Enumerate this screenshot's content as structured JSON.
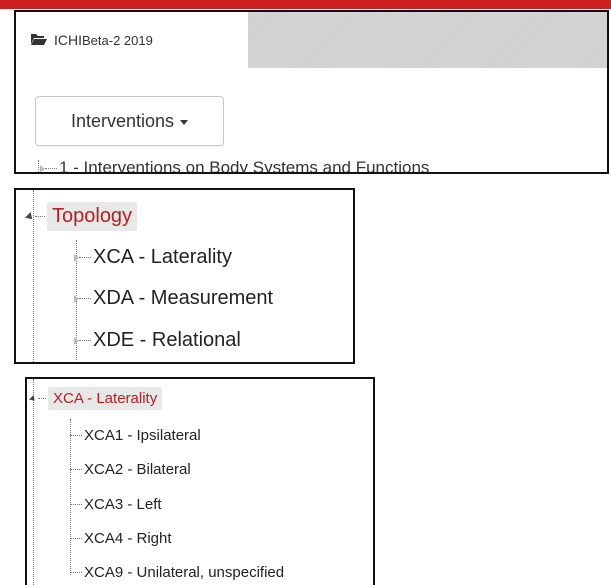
{
  "tab": {
    "icon": "folder-open-icon",
    "label_main": "ICHI ",
    "label_small": "Beta-2 2019"
  },
  "dropdown": {
    "label": "Interventions"
  },
  "tree_top": {
    "item_label": "1 - Interventions on Body Systems and Functions"
  },
  "topology": {
    "label": "Topology",
    "children": [
      {
        "label": "XCA - Laterality"
      },
      {
        "label": "XDA - Measurement"
      },
      {
        "label": "XDE - Relational"
      }
    ]
  },
  "laterality": {
    "label": "XCA - Laterality",
    "children": [
      {
        "label": "XCA1 - Ipsilateral"
      },
      {
        "label": "XCA2 - Bilateral"
      },
      {
        "label": "XCA3 - Left"
      },
      {
        "label": "XCA4 - Right"
      },
      {
        "label": "XCA9 - Unilateral, unspecified"
      }
    ]
  },
  "colors": {
    "accent_red": "#cc1f1f",
    "selected_text": "#b22222",
    "selected_bg": "#e8e8e8"
  }
}
